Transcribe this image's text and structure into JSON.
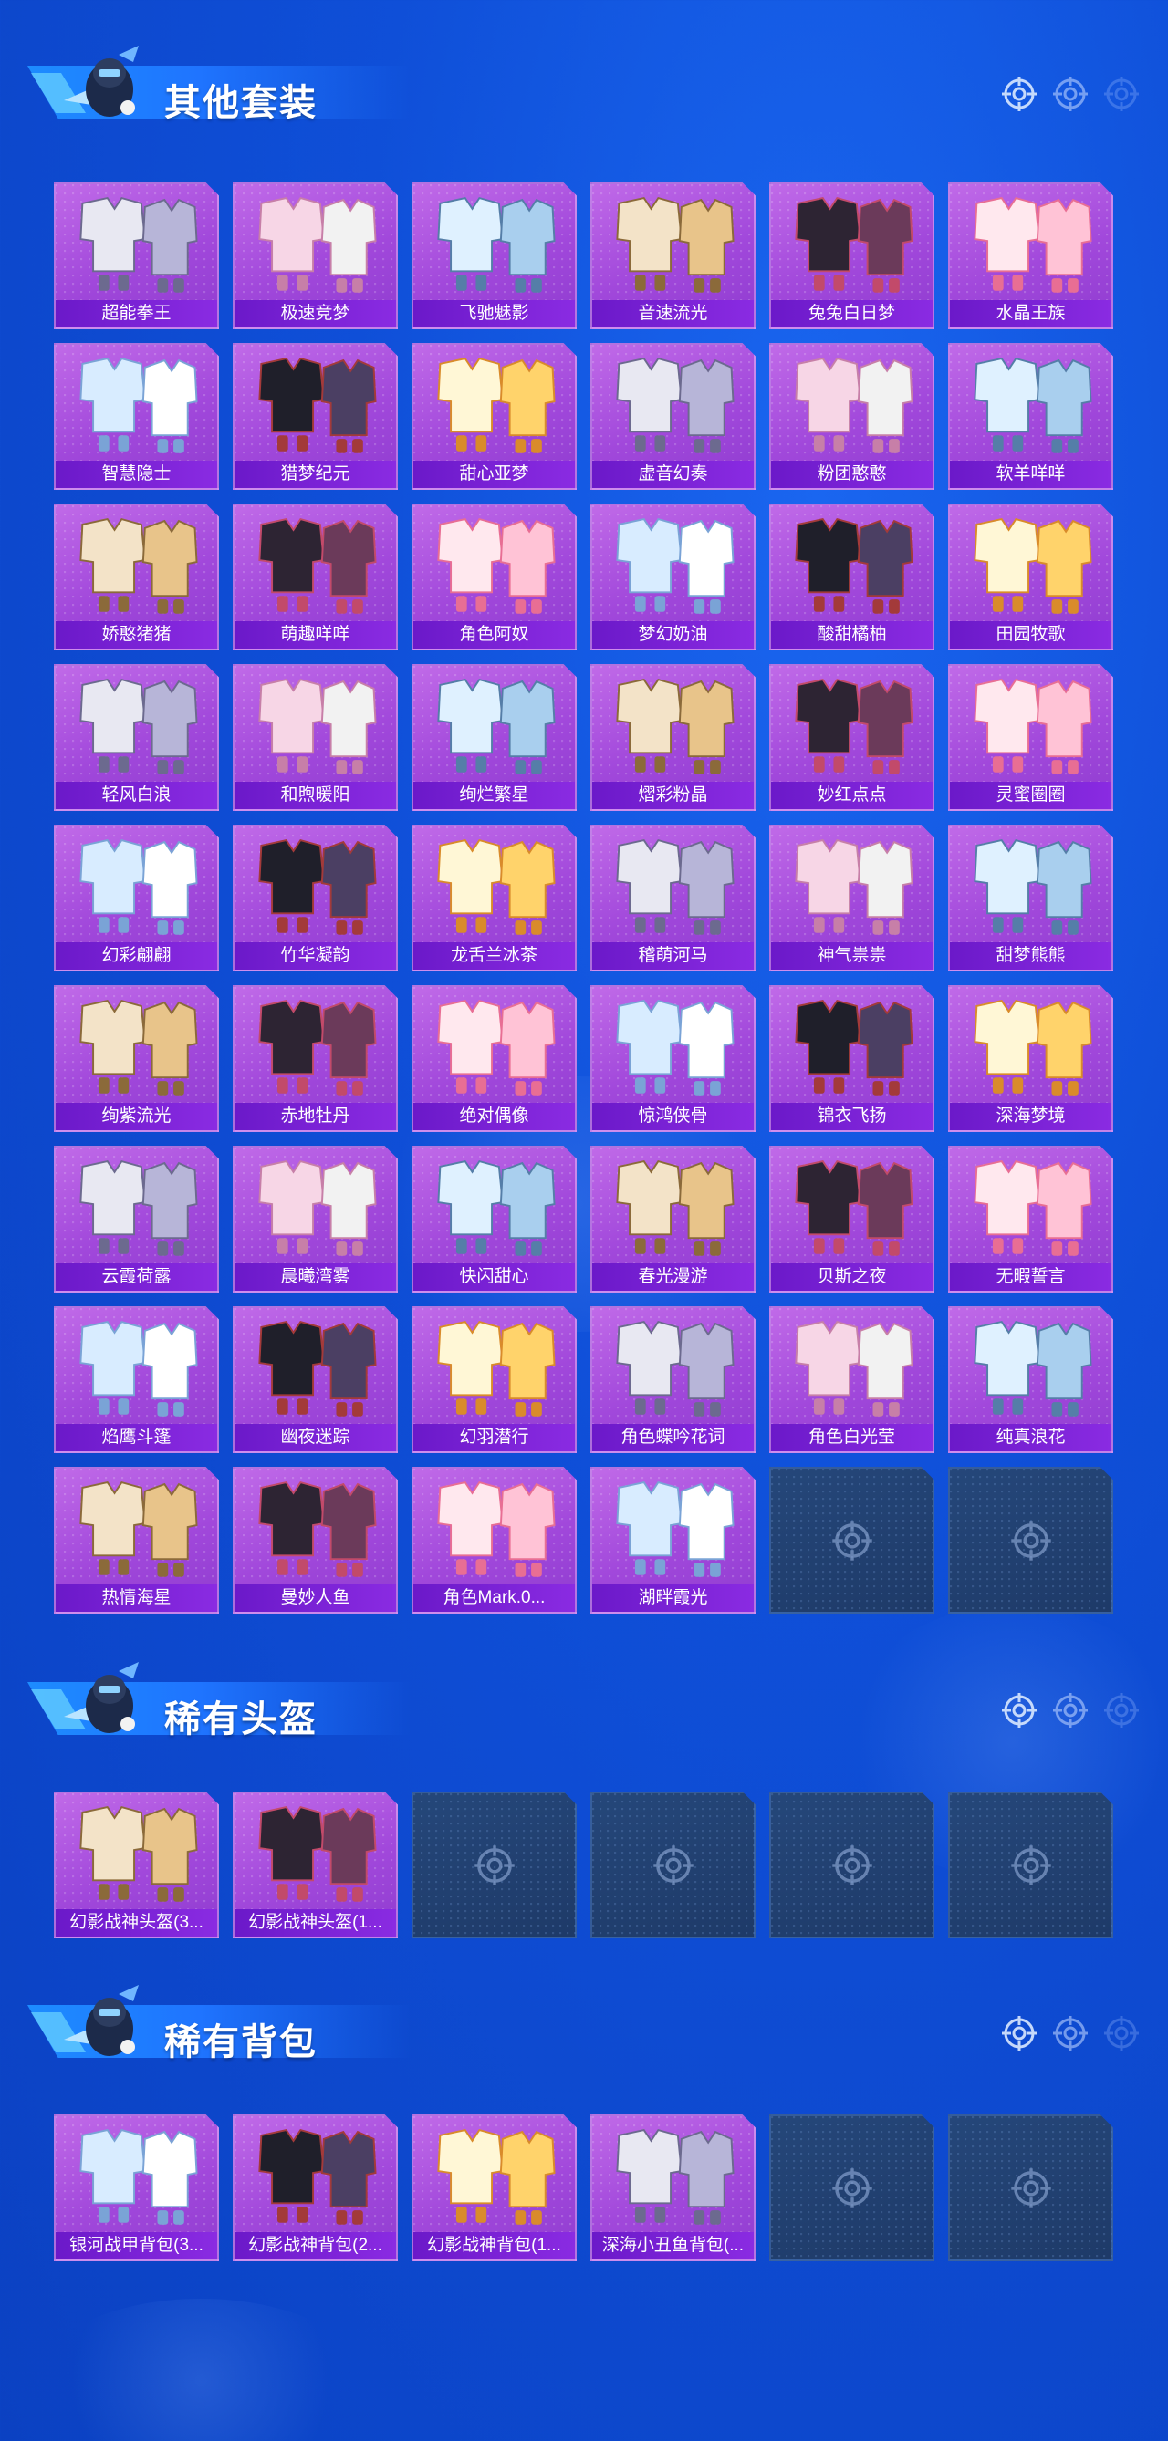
{
  "colors": {
    "accent": "#1f74ff",
    "card_purple": "#a148db",
    "label_purple": "#6b19c9",
    "empty_slot": "#25477a"
  },
  "sections": [
    {
      "title": "其他套装",
      "items": [
        "超能拳王",
        "极速竞梦",
        "飞驰魅影",
        "音速流光",
        "兔兔白日梦",
        "水晶王族",
        "智慧隐士",
        "猎梦纪元",
        "甜心亚梦",
        "虚音幻奏",
        "粉团憨憨",
        "软羊咩咩",
        "娇憨猪猪",
        "萌趣咩咩",
        "角色阿奴",
        "梦幻奶油",
        "酸甜橘柚",
        "田园牧歌",
        "轻风白浪",
        "和煦暖阳",
        "绚烂繁星",
        "熠彩粉晶",
        "妙红点点",
        "灵蜜圈圈",
        "幻彩翩翩",
        "竹华凝韵",
        "龙舌兰冰茶",
        "稽萌河马",
        "神气祟祟",
        "甜梦熊熊",
        "绚紫流光",
        "赤地牡丹",
        "绝对偶像",
        "惊鸿侠骨",
        "锦衣飞扬",
        "深海梦境",
        "云霞荷露",
        "晨曦湾雾",
        "快闪甜心",
        "春光漫游",
        "贝斯之夜",
        "无暇誓言",
        "焰鹰斗篷",
        "幽夜迷踪",
        "幻羽潜行",
        "角色蝶吟花词",
        "角色白光莹",
        "纯真浪花",
        "热情海星",
        "曼妙人鱼",
        "角色Mark.0...",
        "湖畔霞光"
      ],
      "empty_slots": 2
    },
    {
      "title": "稀有头盔",
      "items": [
        "幻影战神头盔(3...",
        "幻影战神头盔(1..."
      ],
      "empty_slots": 4
    },
    {
      "title": "稀有背包",
      "items": [
        "银河战甲背包(3...",
        "幻影战神背包(2...",
        "幻影战神背包(1...",
        "深海小丑鱼背包(..."
      ],
      "empty_slots": 2
    }
  ],
  "icons": {
    "header_targets": "crosshair-icon",
    "empty_slot": "crosshair-icon",
    "mascot": "mascot-icon"
  }
}
